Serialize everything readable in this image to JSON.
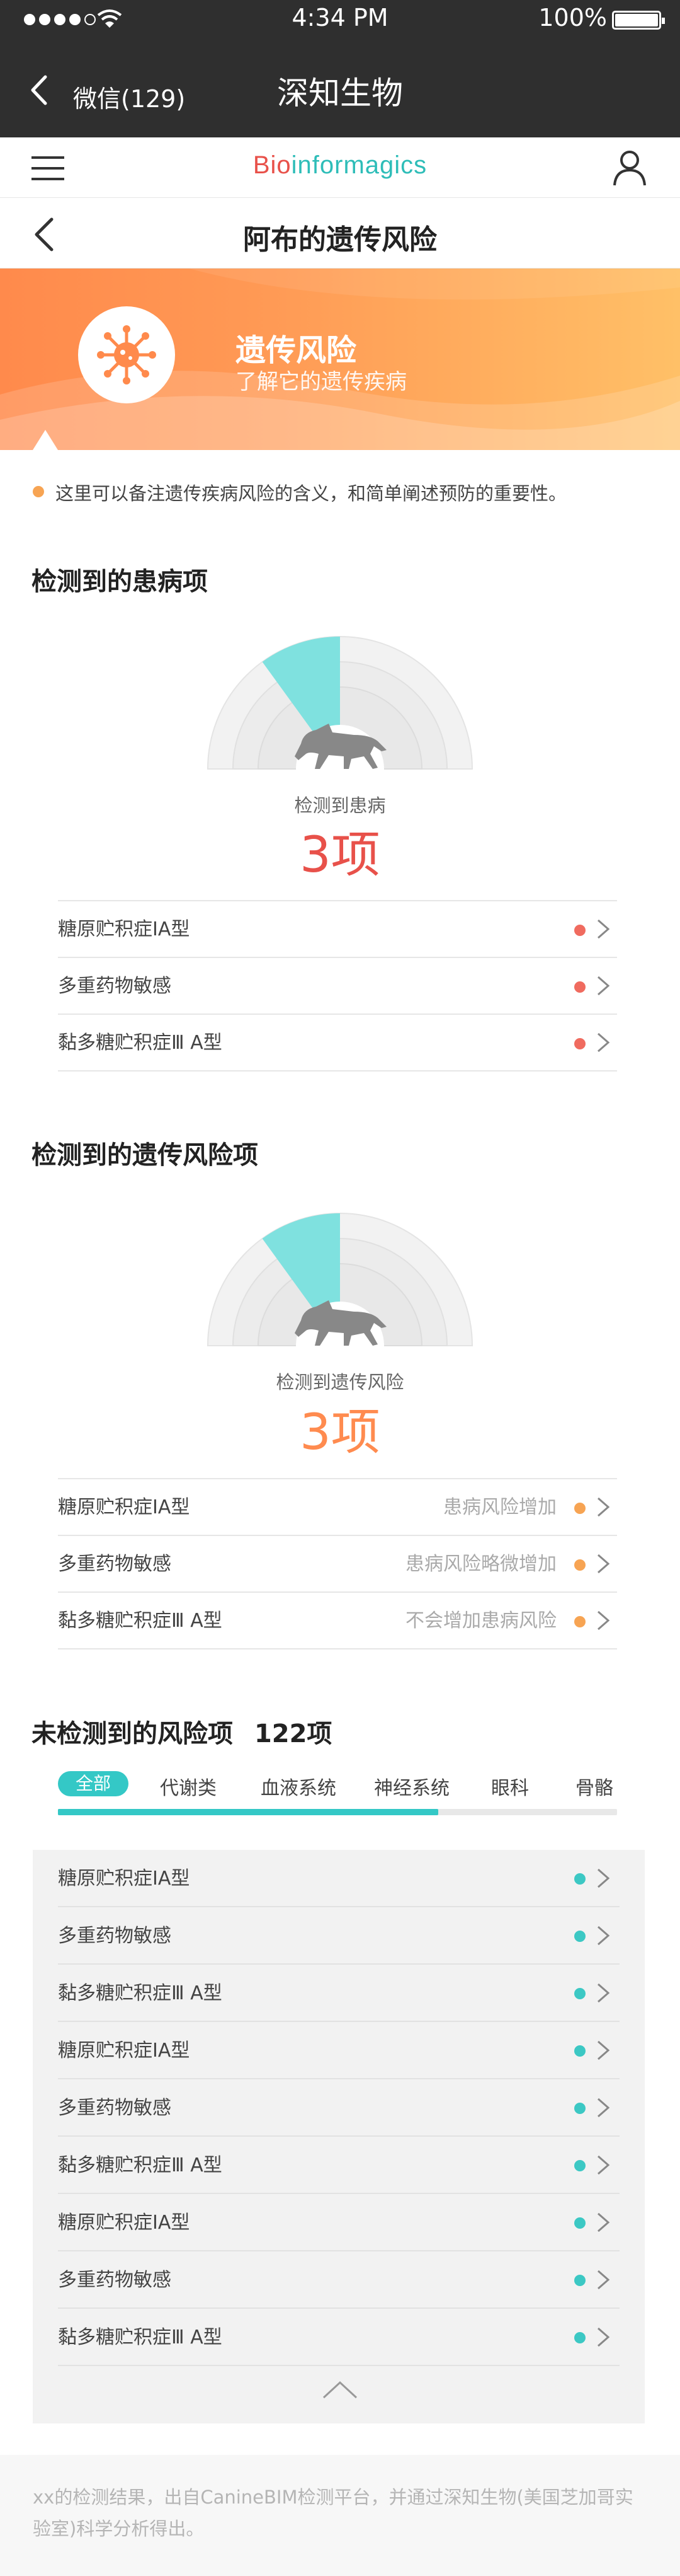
{
  "status_bar": {
    "time": "4:34 PM",
    "battery": "100%"
  },
  "wechat": {
    "back_label": "微信(129)",
    "title": "深知生物"
  },
  "brand": {
    "logo_bio": "Bio",
    "logo_rest": "informagics"
  },
  "page": {
    "title": "阿布的遗传风险"
  },
  "banner": {
    "title": "遗传风险",
    "subtitle": "了解它的遗传疾病"
  },
  "note": "这里可以备注遗传疾病风险的含义，和简单阐述预防的重要性。",
  "colors": {
    "accent_orange": "#ff8b4f",
    "red": "#e8514a",
    "teal": "#34c8c6",
    "dot_red": "#f06b5f",
    "dot_orange": "#f7a453",
    "dot_teal": "#3cc8c4"
  },
  "disease": {
    "section_title": "检测到的患病项",
    "gauge_label": "检测到患病",
    "count": "3项",
    "gauge_fill_fraction": 0.2,
    "items": [
      {
        "label": "糖原贮积症ⅠA型"
      },
      {
        "label": "多重药物敏感"
      },
      {
        "label": "黏多糖贮积症Ⅲ A型"
      }
    ]
  },
  "risk": {
    "section_title": "检测到的遗传风险项",
    "gauge_label": "检测到遗传风险",
    "count": "3项",
    "gauge_fill_fraction": 0.2,
    "items": [
      {
        "label": "糖原贮积症ⅠA型",
        "status": "患病风险增加"
      },
      {
        "label": "多重药物敏感",
        "status": "患病风险略微增加"
      },
      {
        "label": "黏多糖贮积症Ⅲ A型",
        "status": "不会增加患病风险"
      }
    ]
  },
  "undetected": {
    "section_title": "未检测到的风险项",
    "count": "122项",
    "tabs": [
      {
        "label": "全部"
      },
      {
        "label": "代谢类"
      },
      {
        "label": "血液系统"
      },
      {
        "label": "神经系统"
      },
      {
        "label": "眼科"
      },
      {
        "label": "骨骼"
      }
    ],
    "scroll_progress": 0.68,
    "items": [
      {
        "label": "糖原贮积症ⅠA型"
      },
      {
        "label": "多重药物敏感"
      },
      {
        "label": "黏多糖贮积症Ⅲ A型"
      },
      {
        "label": "糖原贮积症ⅠA型"
      },
      {
        "label": "多重药物敏感"
      },
      {
        "label": "黏多糖贮积症Ⅲ A型"
      },
      {
        "label": "糖原贮积症ⅠA型"
      },
      {
        "label": "多重药物敏感"
      },
      {
        "label": "黏多糖贮积症Ⅲ A型"
      }
    ]
  },
  "footer": {
    "text": "xx的检测结果，出自CanineBIM检测平台，并通过深知生物(美国芝加哥实验室)科学分析得出。"
  }
}
